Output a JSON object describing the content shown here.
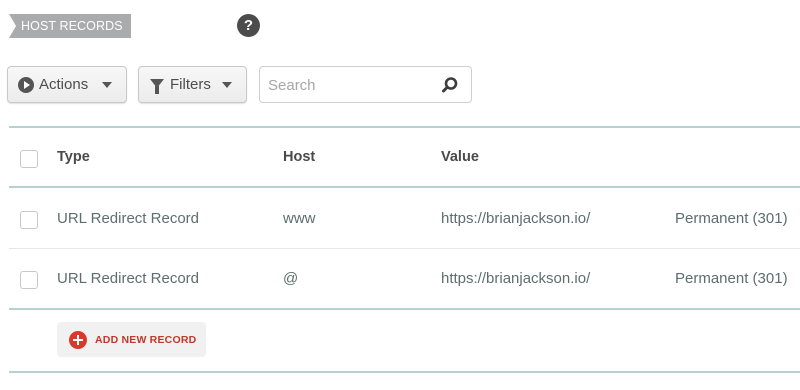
{
  "section": {
    "title": "HOST RECORDS",
    "help_glyph": "?"
  },
  "toolbar": {
    "actions_label": "Actions",
    "filters_label": "Filters",
    "search_placeholder": "Search",
    "search_value": ""
  },
  "table": {
    "columns": [
      "Type",
      "Host",
      "Value"
    ],
    "rows": [
      {
        "type": "URL Redirect Record",
        "host": "www",
        "value": "https://brianjackson.io/",
        "redirect": "Permanent (301)"
      },
      {
        "type": "URL Redirect Record",
        "host": "@",
        "value": "https://brianjackson.io/",
        "redirect": "Permanent (301)"
      }
    ]
  },
  "add_record": {
    "label": "ADD NEW RECORD"
  },
  "colors": {
    "accent_red": "#d8392b",
    "rule_teal": "#b8d0d0",
    "tag_gray": "#a9abad"
  },
  "icons": [
    "help-icon",
    "play-icon",
    "filter-icon",
    "caret-down-icon",
    "search-icon",
    "plus-circle-icon"
  ]
}
